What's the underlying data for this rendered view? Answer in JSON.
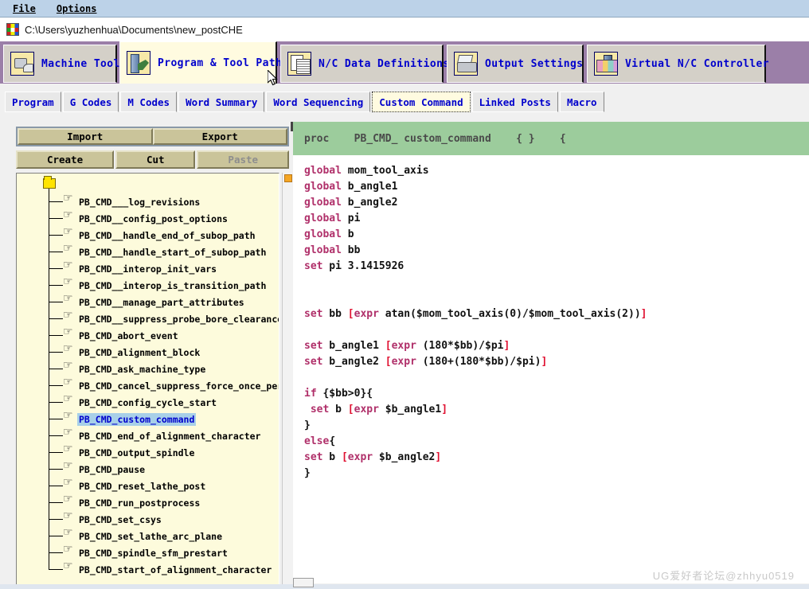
{
  "menubar": {
    "items": [
      {
        "label": "File"
      },
      {
        "label": "Options"
      }
    ]
  },
  "titlebar": {
    "icon": "post-builder-icon",
    "path": "C:\\Users\\yuzhenhua\\Documents\\new_postCHE"
  },
  "main_tabs": [
    {
      "label": "Machine Tool",
      "icon": "machine-tool-icon",
      "active": false
    },
    {
      "label": "Program & Tool Path",
      "icon": "program-tool-path-icon",
      "active": true
    },
    {
      "label": "N/C Data Definitions",
      "icon": "nc-data-definitions-icon",
      "active": false
    },
    {
      "label": "Output Settings",
      "icon": "output-settings-icon",
      "active": false
    },
    {
      "label": "Virtual N/C Controller",
      "icon": "virtual-nc-controller-icon",
      "active": false
    }
  ],
  "sub_tabs": [
    {
      "label": "Program",
      "active": false
    },
    {
      "label": "G Codes",
      "active": false
    },
    {
      "label": "M Codes",
      "active": false
    },
    {
      "label": "Word Summary",
      "active": false
    },
    {
      "label": "Word Sequencing",
      "active": false
    },
    {
      "label": "Custom Command",
      "active": true
    },
    {
      "label": "Linked Posts",
      "active": false
    },
    {
      "label": "Macro",
      "active": false
    }
  ],
  "toolbar": {
    "import_label": "Import",
    "export_label": "Export",
    "create_label": "Create",
    "cut_label": "Cut",
    "paste_label": "Paste"
  },
  "tree": {
    "root_icon": "folder-icon",
    "items": [
      {
        "label": "PB_CMD___log_revisions",
        "selected": false
      },
      {
        "label": "PB_CMD__config_post_options",
        "selected": false
      },
      {
        "label": "PB_CMD__handle_end_of_subop_path",
        "selected": false
      },
      {
        "label": "PB_CMD__handle_start_of_subop_path",
        "selected": false
      },
      {
        "label": "PB_CMD__interop_init_vars",
        "selected": false
      },
      {
        "label": "PB_CMD__interop_is_transition_path",
        "selected": false
      },
      {
        "label": "PB_CMD__manage_part_attributes",
        "selected": false
      },
      {
        "label": "PB_CMD__suppress_probe_bore_clearance_r",
        "selected": false
      },
      {
        "label": "PB_CMD_abort_event",
        "selected": false
      },
      {
        "label": "PB_CMD_alignment_block",
        "selected": false
      },
      {
        "label": "PB_CMD_ask_machine_type",
        "selected": false
      },
      {
        "label": "PB_CMD_cancel_suppress_force_once_per_e",
        "selected": false
      },
      {
        "label": "PB_CMD_config_cycle_start",
        "selected": false
      },
      {
        "label": "PB_CMD_custom_command",
        "selected": true
      },
      {
        "label": "PB_CMD_end_of_alignment_character",
        "selected": false
      },
      {
        "label": "PB_CMD_output_spindle",
        "selected": false
      },
      {
        "label": "PB_CMD_pause",
        "selected": false
      },
      {
        "label": "PB_CMD_reset_lathe_post",
        "selected": false
      },
      {
        "label": "PB_CMD_run_postprocess",
        "selected": false
      },
      {
        "label": "PB_CMD_set_csys",
        "selected": false
      },
      {
        "label": "PB_CMD_set_lathe_arc_plane",
        "selected": false
      },
      {
        "label": "PB_CMD_spindle_sfm_prestart",
        "selected": false
      },
      {
        "label": "PB_CMD_start_of_alignment_character",
        "selected": false
      }
    ]
  },
  "editor": {
    "header": "proc    PB_CMD_ custom_command    { }    {",
    "lines": [
      "global mom_tool_axis",
      "global b_angle1",
      "global b_angle2",
      "global pi",
      "global b",
      "global bb",
      "set pi 3.1415926",
      "",
      "",
      "set bb [expr atan($mom_tool_axis(0)/$mom_tool_axis(2))]",
      "",
      "set b_angle1 [expr (180*$bb)/$pi]",
      "set b_angle2 [expr (180+(180*$bb)/$pi)]",
      "",
      "if {$bb>0}{",
      " set b [expr $b_angle1]",
      "}",
      "else{",
      "set b [expr $b_angle2]",
      "}"
    ]
  },
  "watermark": {
    "text": "UG爱好者论坛@zhhyu0519"
  },
  "colors": {
    "menubar_bg": "#bcd2e8",
    "tabstrip_bg": "#9b7fa8",
    "tab_text": "#0000cc",
    "active_tab_bg": "#fffbe0",
    "button_bg": "#cac49a",
    "tree_bg": "#fdfbdc",
    "selection_bg": "#a8d0e8",
    "code_header_bg": "#9ccc9c",
    "keyword": "#b0306a",
    "bracket": "#e01030",
    "scroll_thumb": "#f5a623"
  }
}
